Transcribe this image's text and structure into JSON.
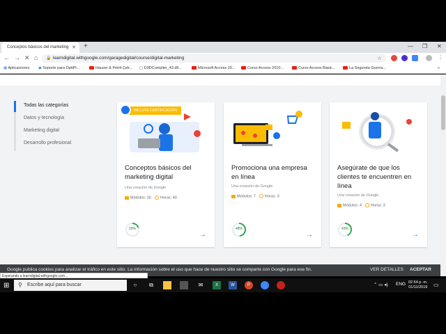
{
  "browser": {
    "tab_title": "Conceptos básicos del marketing",
    "url": "learndigital.withgoogle.com/garagedigital/course/digital-marketing",
    "bookmarks": [
      "Aplicaciones",
      "Soporte para OptiPl...",
      "Hauser & Petrit Çek...",
      "D3DCompiler_43.dll...",
      "Microsoft Access 20...",
      "Curso Access 2010...",
      "Curso Access Básic...",
      "La Segunda Guerra..."
    ],
    "status": "Esperando a learndigital.withgoogle.com..."
  },
  "sidebar": {
    "categories": [
      "Todas las categorías",
      "Datos y tecnología",
      "Marketing digital",
      "Desarrollo profesional"
    ]
  },
  "cards": [
    {
      "badge": "INCLUYE CERTIFICACIÓN",
      "title": "Conceptos básicos del marketing digital",
      "by": "Una creación de Google",
      "modules": "Módulos: 26",
      "hours": "Horas: 40",
      "progress": "20%",
      "progress_value": 0.2
    },
    {
      "title": "Promociona una empresa en línea",
      "by": "Una creación de Google",
      "modules": "Módulos: 7",
      "hours": "Horas: 3",
      "progress": "48%",
      "progress_value": 0.48
    },
    {
      "title": "Asegúrate de que los clientes te encuentren en línea",
      "by": "Una creación de Google",
      "modules": "Módulos: 4",
      "hours": "Horas: 3",
      "progress": "43%",
      "progress_value": 0.43
    }
  ],
  "cookie": {
    "text": "Google publica cookies para analizar el tráfico en este sitio. La información sobre el uso que hace de nuestro sitio se comparte con Google para ese fin.",
    "details": "VER DETALLES",
    "accept": "ACEPTAR"
  },
  "taskbar": {
    "search_placeholder": "Escribe aquí para buscar",
    "lang": "ENG",
    "time": "02:54 p. m.",
    "date": "01/11/2019"
  },
  "colors": {
    "accent": "#1a73e8",
    "progress": "#34a853",
    "badge": "#fbbc04"
  }
}
